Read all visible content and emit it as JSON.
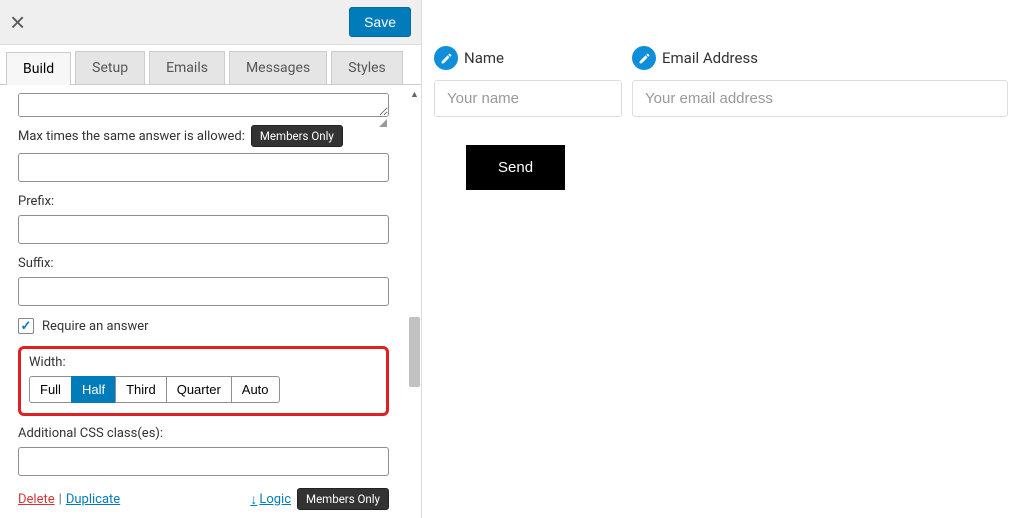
{
  "header": {
    "save_label": "Save"
  },
  "tabs": [
    "Build",
    "Setup",
    "Emails",
    "Messages",
    "Styles"
  ],
  "panel": {
    "max_times_label": "Max times the same answer is allowed:",
    "members_only": "Members Only",
    "prefix_label": "Prefix:",
    "suffix_label": "Suffix:",
    "require_label": "Require an answer",
    "width_label": "Width:",
    "width_options": [
      "Full",
      "Half",
      "Third",
      "Quarter",
      "Auto"
    ],
    "width_active": "Half",
    "additional_classes_label": "Additional CSS class(es):"
  },
  "footer": {
    "delete": "Delete",
    "duplicate": "Duplicate",
    "logic": "Logic",
    "members_only": "Members Only"
  },
  "preview": {
    "name_label": "Name",
    "name_placeholder": "Your name",
    "email_label": "Email Address",
    "email_placeholder": "Your email address",
    "send": "Send"
  }
}
